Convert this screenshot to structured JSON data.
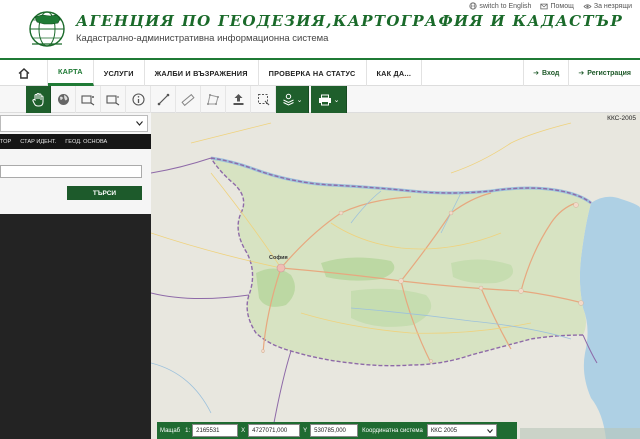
{
  "header": {
    "title": "АГЕНЦИЯ ПО ГЕОДЕЗИЯ,КАРТОГРАФИЯ И КАДАСТЪР",
    "subtitle": "Кадастрално-административна информационна система",
    "links": [
      {
        "label": "switch to English",
        "icon": "globe-icon"
      },
      {
        "label": "Помощ",
        "icon": "mail-icon"
      },
      {
        "label": "За незрящи",
        "icon": "eye-icon"
      }
    ]
  },
  "nav": {
    "items": [
      "КАРТА",
      "УСЛУГИ",
      "ЖАЛБИ И ВЪЗРАЖЕНИЯ",
      "ПРОВЕРКА НА СТАТУС",
      "КАК ДА..."
    ],
    "active_index": 0,
    "login": "Вход",
    "register": "Регистрация"
  },
  "toolbar": {
    "tools": [
      "pan-hand-icon",
      "globe-icon",
      "add-layer-icon",
      "remove-layer-icon",
      "info-icon",
      "measure-line-icon",
      "measure-area-icon",
      "upload-icon",
      "select-region-icon",
      "layers-icon",
      "print-icon"
    ]
  },
  "panel": {
    "tabs": [
      "ТОР",
      "СТАР ИДЕНТ.",
      "ГЕОД. ОСНОВА"
    ],
    "search_value": "",
    "search_button": "ТЪРСИ"
  },
  "map": {
    "corner_label": "ККС-2005",
    "capital_label": "София",
    "country_color": "#d7e3c2",
    "sea_color": "#aed0e4",
    "border_color": "#8e6aa8"
  },
  "coordbar": {
    "scale_label": "Мащаб",
    "scale_prefix": "1:",
    "scale_value": "2165531",
    "x_label": "X",
    "x_value": "4727071,000",
    "y_label": "Y",
    "y_value": "530785,000",
    "system_label": "Координатна система",
    "system_value": "ККС 2005"
  }
}
